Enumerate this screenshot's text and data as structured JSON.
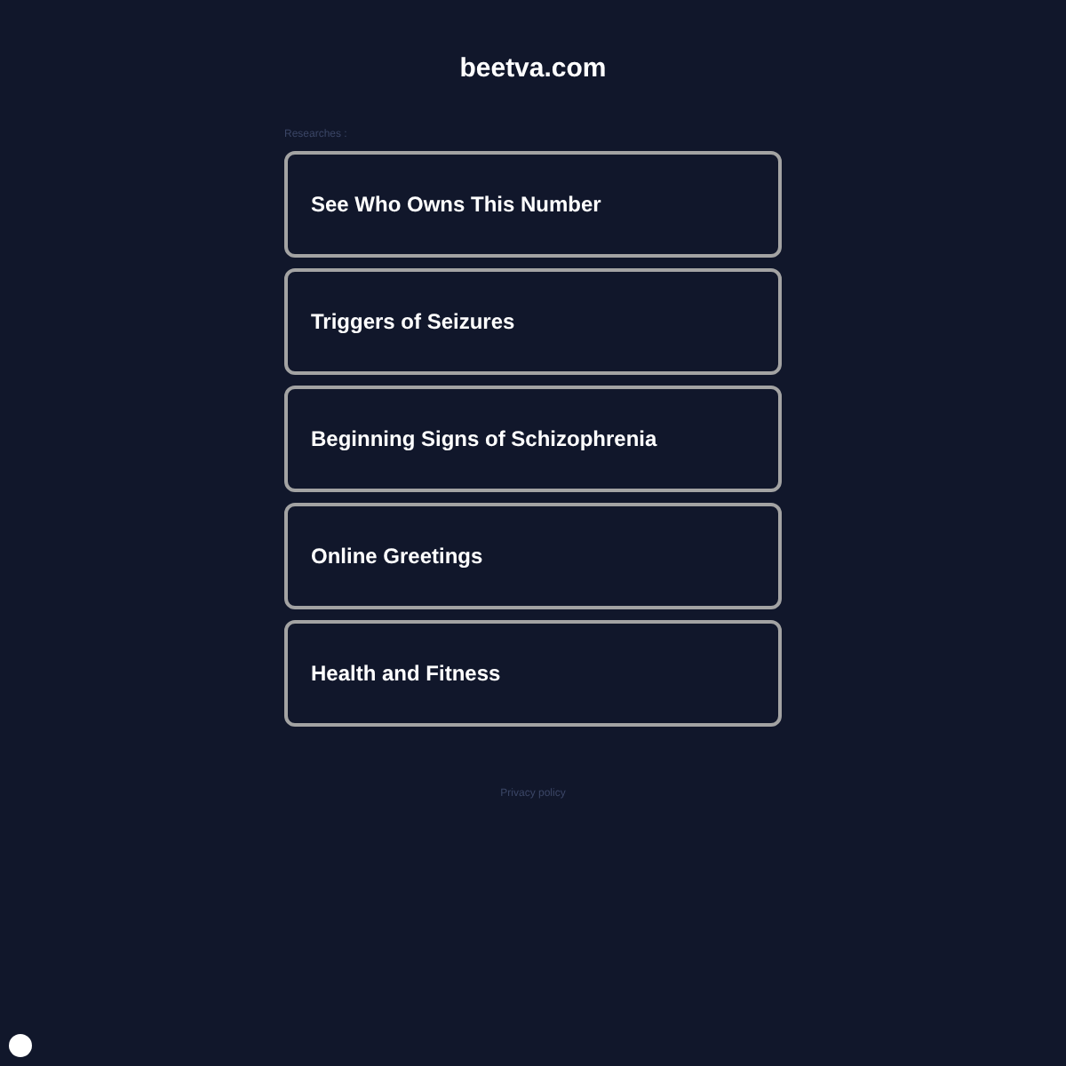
{
  "site_title": "beetva.com",
  "section_label": "Researches :",
  "links": [
    {
      "label": "See Who Owns This Number"
    },
    {
      "label": "Triggers of Seizures"
    },
    {
      "label": "Beginning Signs of Schizophrenia"
    },
    {
      "label": "Online Greetings"
    },
    {
      "label": "Health and Fitness"
    }
  ],
  "footer_link": "Privacy policy"
}
